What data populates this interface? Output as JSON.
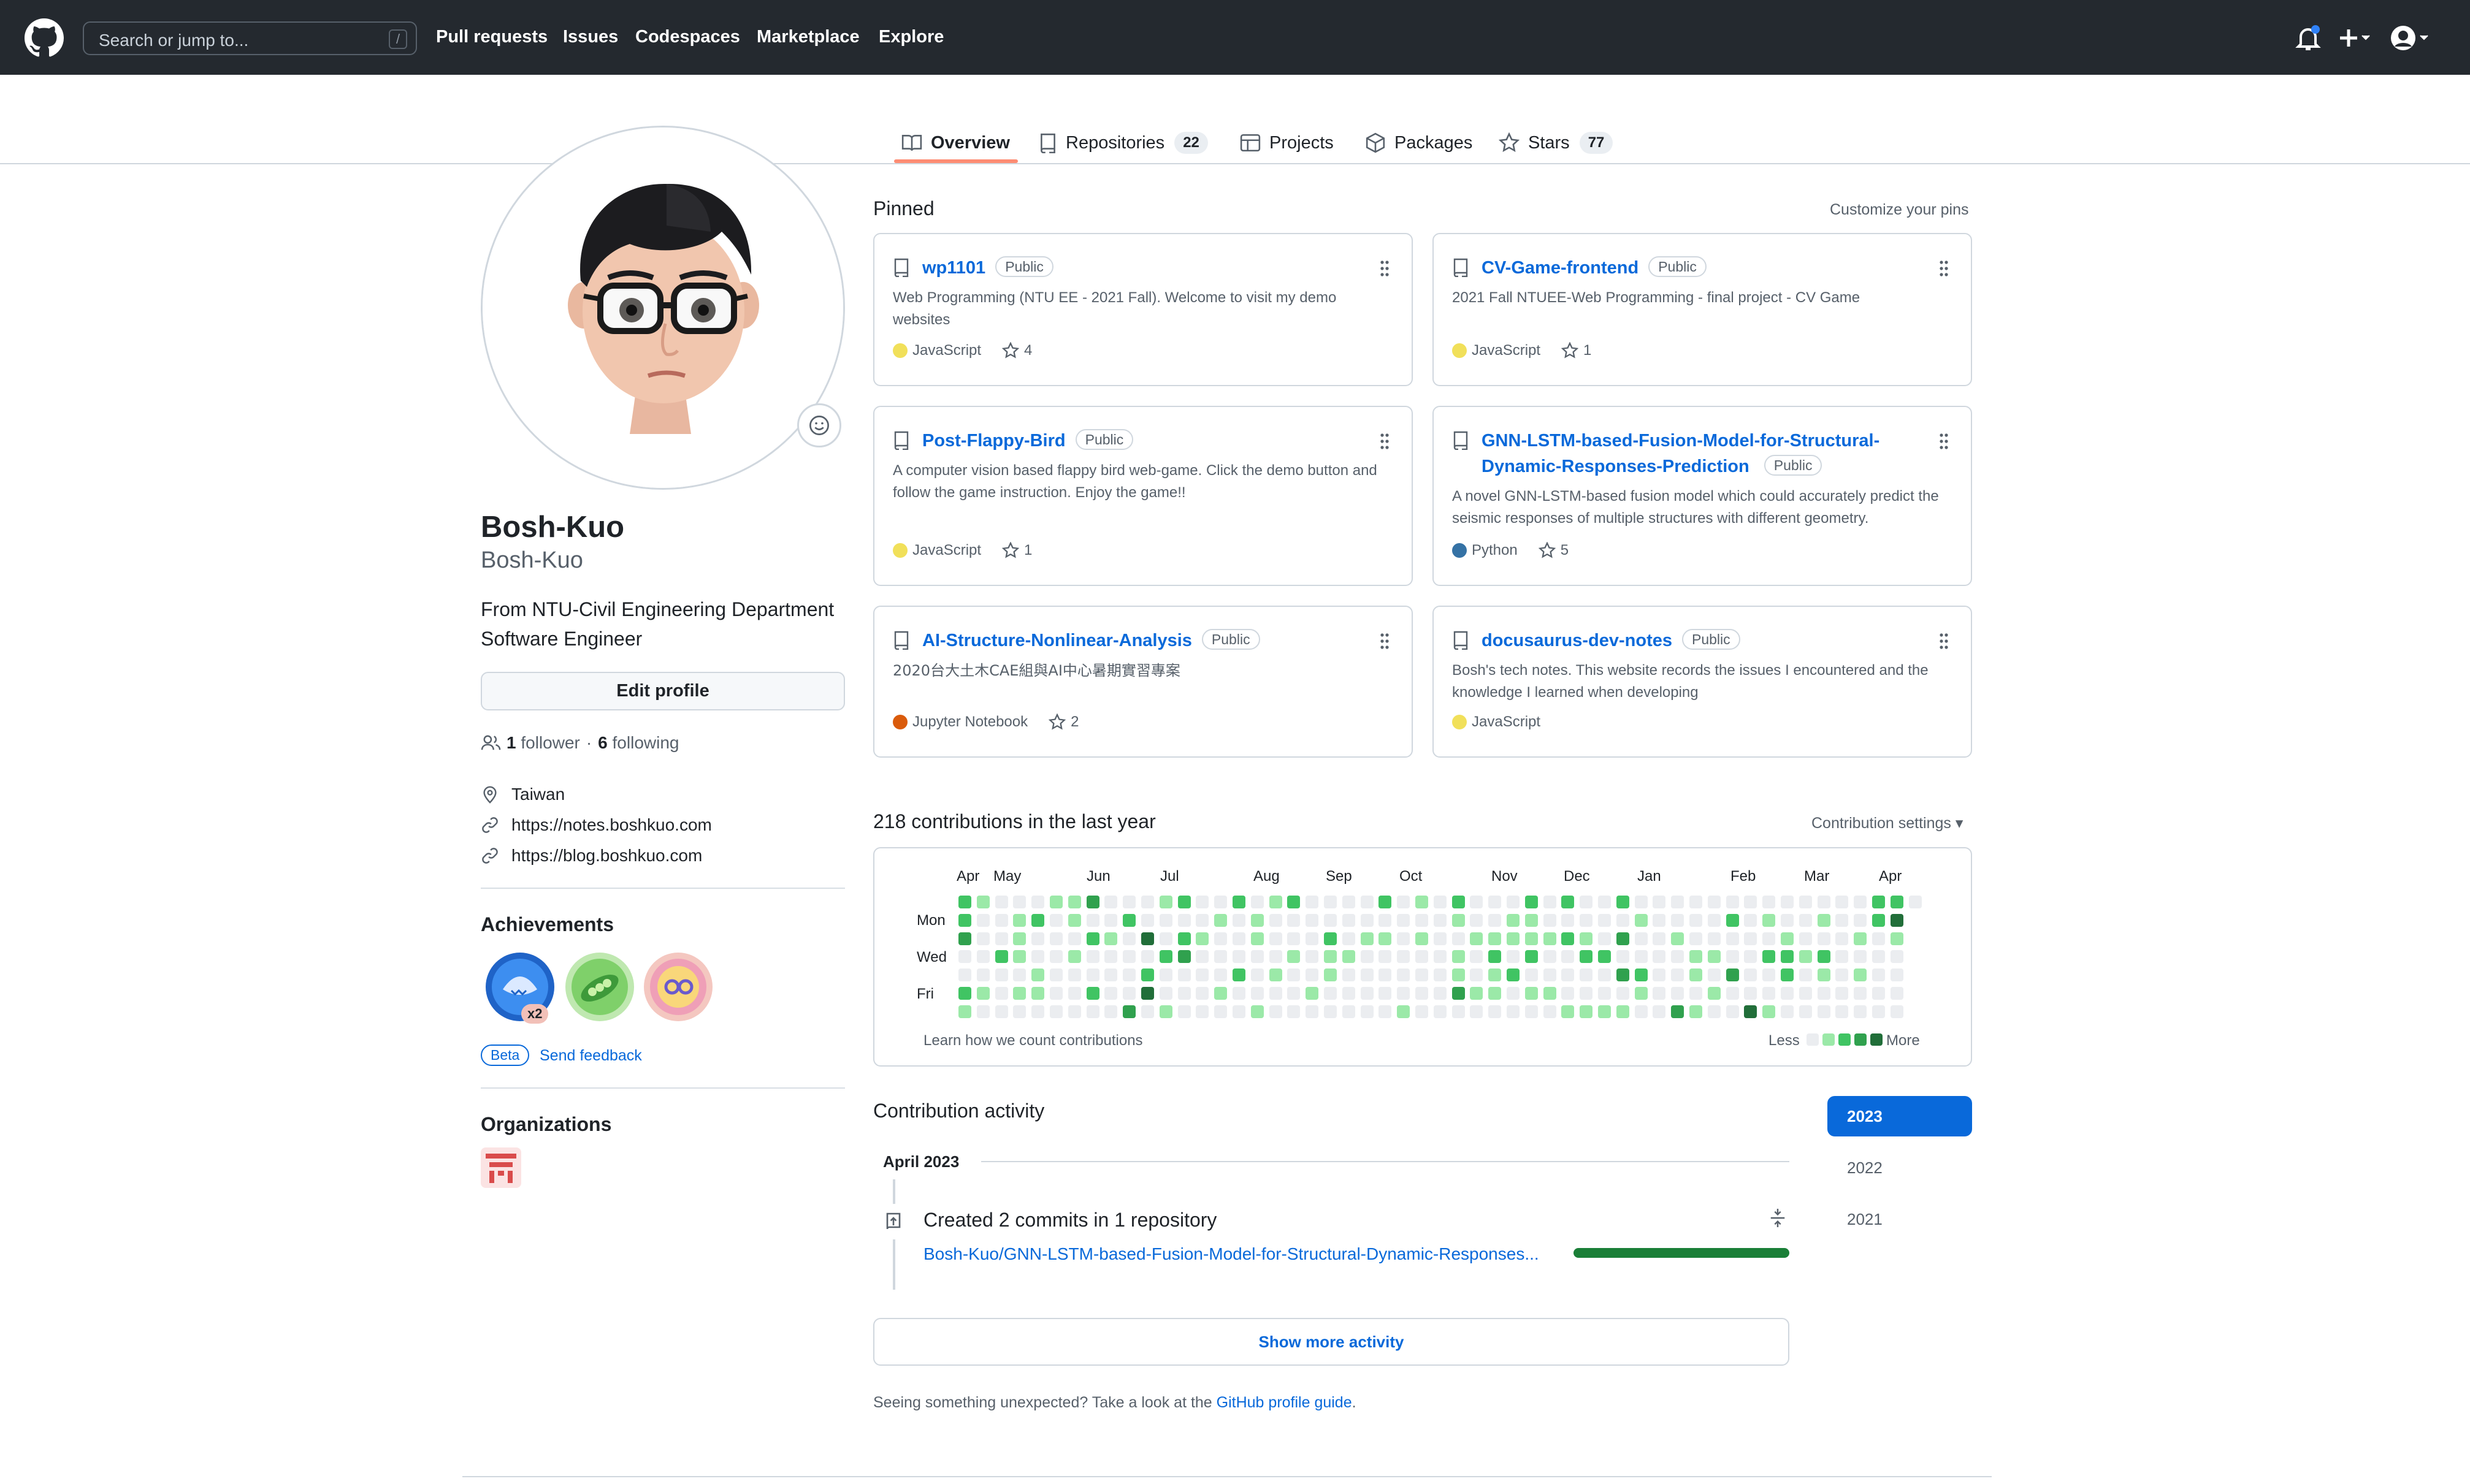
{
  "header": {
    "search_placeholder": "Search or jump to...",
    "search_key": "/",
    "nav": [
      "Pull requests",
      "Issues",
      "Codespaces",
      "Marketplace",
      "Explore"
    ],
    "bg_color": "#24292f"
  },
  "tabs": [
    {
      "label": "Overview",
      "count": null,
      "icon": "book-icon",
      "active": true
    },
    {
      "label": "Repositories",
      "count": "22",
      "icon": "repo-icon",
      "active": false
    },
    {
      "label": "Projects",
      "count": null,
      "icon": "table-icon",
      "active": false
    },
    {
      "label": "Packages",
      "count": null,
      "icon": "package-icon",
      "active": false
    },
    {
      "label": "Stars",
      "count": "77",
      "icon": "star-icon",
      "active": false
    }
  ],
  "profile": {
    "name": "Bosh-Kuo",
    "login": "Bosh-Kuo",
    "bio_lines": [
      "From NTU-Civil Engineering Department",
      "Software Engineer"
    ],
    "edit_label": "Edit profile",
    "followers": "1",
    "followers_label": "follower",
    "dot": "·",
    "following": "6",
    "following_label": "following",
    "location": "Taiwan",
    "links": [
      "https://notes.boshkuo.com",
      "https://blog.boshkuo.com"
    ],
    "achievements_title": "Achievements",
    "achievement_multiplier": "x2",
    "beta_label": "Beta",
    "send_feedback": "Send feedback",
    "organizations_title": "Organizations"
  },
  "pinned": {
    "title": "Pinned",
    "customize": "Customize your pins",
    "items": [
      {
        "name": "wp1101",
        "visibility": "Public",
        "desc": "Web Programming (NTU EE - 2021 Fall). Welcome to visit my demo websites",
        "lang": "JavaScript",
        "lang_color": "#f1e05a",
        "stars": "4"
      },
      {
        "name": "CV-Game-frontend",
        "visibility": "Public",
        "desc": "2021 Fall NTUEE-Web Programming - final project - CV Game",
        "lang": "JavaScript",
        "lang_color": "#f1e05a",
        "stars": "1"
      },
      {
        "name": "Post-Flappy-Bird",
        "visibility": "Public",
        "desc": "A computer vision based flappy bird web-game. Click the demo button and follow the game instruction. Enjoy the game!!",
        "lang": "JavaScript",
        "lang_color": "#f1e05a",
        "stars": "1"
      },
      {
        "name_lines": [
          "GNN-LSTM-based-Fusion-Model-for-Structural-",
          "Dynamic-Responses-Prediction"
        ],
        "visibility": "Public",
        "desc": "A novel GNN-LSTM-based fusion model which could accurately predict the seismic responses of multiple structures with different geometry.",
        "lang": "Python",
        "lang_color": "#3572A5",
        "stars": "5"
      },
      {
        "name": "AI-Structure-Nonlinear-Analysis",
        "visibility": "Public",
        "desc": "2020台大土木CAE組與AI中心暑期實習專案",
        "lang": "Jupyter Notebook",
        "lang_color": "#DA5B0B",
        "stars": "2"
      },
      {
        "name": "docusaurus-dev-notes",
        "visibility": "Public",
        "desc": "Bosh's tech notes. This website records the issues I encountered and the knowledge I learned when developing",
        "lang": "JavaScript",
        "lang_color": "#f1e05a",
        "stars": null
      }
    ]
  },
  "contributions": {
    "title": "218 contributions in the last year",
    "settings": "Contribution settings",
    "months": [
      "Apr",
      "May",
      "Jun",
      "Jul",
      "Aug",
      "Sep",
      "Oct",
      "Nov",
      "Dec",
      "Jan",
      "Feb",
      "Mar",
      "Apr"
    ],
    "days": [
      "Mon",
      "Wed",
      "Fri"
    ],
    "learn": "Learn how we count contributions",
    "less": "Less",
    "more": "More",
    "colors": [
      "#ebedf0",
      "#9be9a8",
      "#40c463",
      "#30a14e",
      "#216e39"
    ]
  },
  "activity": {
    "title": "Contribution activity",
    "years": [
      "2023",
      "2022",
      "2021"
    ],
    "month": "April 2023",
    "created": "Created 2 commits in 1 repository",
    "repo": "Bosh-Kuo/GNN-LSTM-based-Fusion-Model-for-Structural-Dynamic-Responses...",
    "show_more": "Show more activity",
    "unexpected_prefix": "Seeing something unexpected? Take a look at the ",
    "guide_link": "GitHub profile guide",
    "unexpected_suffix": "."
  }
}
